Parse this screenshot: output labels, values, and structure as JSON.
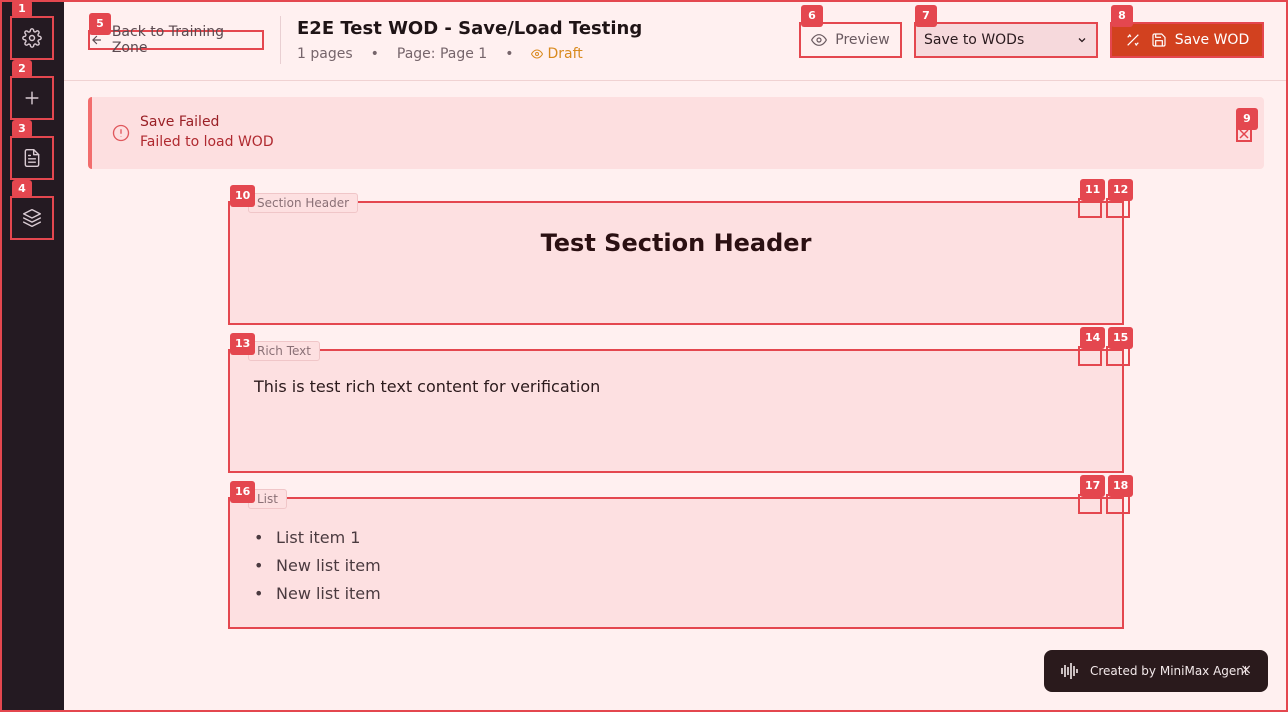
{
  "sidebar": {
    "items": [
      {
        "badge": "1",
        "icon": "gear-icon"
      },
      {
        "badge": "2",
        "icon": "plus-icon"
      },
      {
        "badge": "3",
        "icon": "document-icon"
      },
      {
        "badge": "4",
        "icon": "layers-icon"
      }
    ]
  },
  "header": {
    "back_label": "Back to Training Zone",
    "back_badge": "5",
    "title": "E2E Test WOD - Save/Load Testing",
    "pages_count": "1 pages",
    "separator": "•",
    "page_label": "Page: Page 1",
    "status": "Draft",
    "preview_label": "Preview",
    "preview_badge": "6",
    "save_target": "Save to WODs",
    "save_target_badge": "7",
    "save_label": "Save WOD",
    "save_badge": "8"
  },
  "alert": {
    "title": "Save Failed",
    "message": "Failed to load WOD",
    "close_badge": "9"
  },
  "sections": {
    "header_section": {
      "tag": "Section Header",
      "badge": "10",
      "ctrl_badges": [
        "11",
        "12"
      ],
      "content": "Test Section Header"
    },
    "rich_text_section": {
      "tag": "Rich Text",
      "badge": "13",
      "ctrl_badges": [
        "14",
        "15"
      ],
      "content": "This is test rich text content for verification"
    },
    "list_section": {
      "tag": "List",
      "badge": "16",
      "ctrl_badges": [
        "17",
        "18"
      ],
      "items": [
        "List item 1",
        "New list item",
        "New list item"
      ]
    }
  },
  "toast": {
    "label": "Created by MiniMax Agent",
    "close": "×"
  },
  "colors": {
    "accent": "#e4474f",
    "save_button": "#d2411f",
    "sidebar_bg": "#241a22",
    "draft": "#d98a1e"
  }
}
